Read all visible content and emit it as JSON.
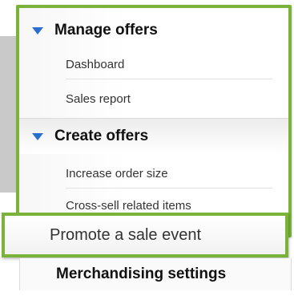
{
  "menu": {
    "manage_offers": {
      "label": "Manage offers",
      "items": [
        {
          "label": "Dashboard"
        },
        {
          "label": "Sales report"
        }
      ]
    },
    "create_offers": {
      "label": "Create offers",
      "items": [
        {
          "label": "Increase order size"
        },
        {
          "label": "Cross-sell related items"
        }
      ]
    },
    "highlighted_item": {
      "label": "Promote a sale event"
    },
    "merchandising_settings": {
      "label": "Merchandising settings"
    }
  },
  "colors": {
    "highlight_border": "#7bb23a",
    "triangle": "#2a6fcf"
  },
  "icons": [
    "triangle-down-icon",
    "triangle-down-icon"
  ]
}
